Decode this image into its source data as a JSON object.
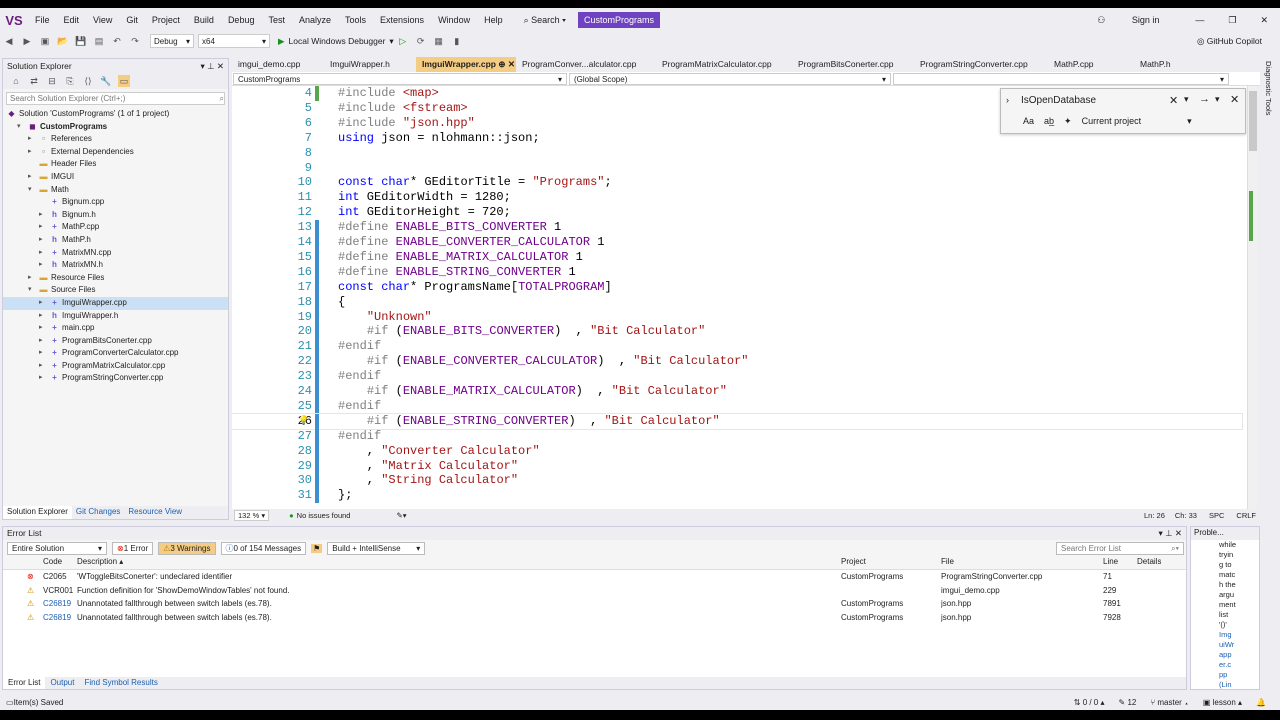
{
  "menu": {
    "logo": "VS",
    "items": [
      "File",
      "Edit",
      "View",
      "Git",
      "Project",
      "Build",
      "Debug",
      "Test",
      "Analyze",
      "Tools",
      "Extensions",
      "Window",
      "Help"
    ],
    "search": "Search",
    "solution_name": "CustomPrograms",
    "sign_in": "Sign in"
  },
  "toolbar": {
    "config": "Debug",
    "platform": "x64",
    "run_label": "Local Windows Debugger",
    "copilot": "GitHub Copilot"
  },
  "solution_explorer": {
    "title": "Solution Explorer",
    "search_placeholder": "Search Solution Explorer (Ctrl+;)",
    "solution_label": "Solution 'CustomPrograms' (1 of 1 project)",
    "items": [
      {
        "label": "CustomPrograms",
        "indent": 1,
        "icon": "project",
        "arrow": "▾",
        "bold": true
      },
      {
        "label": "References",
        "indent": 2,
        "icon": "ref",
        "arrow": "▸"
      },
      {
        "label": "External Dependencies",
        "indent": 2,
        "icon": "ref",
        "arrow": "▸"
      },
      {
        "label": "Header Files",
        "indent": 2,
        "icon": "folder",
        "arrow": ""
      },
      {
        "label": "IMGUI",
        "indent": 2,
        "icon": "folder",
        "arrow": "▸"
      },
      {
        "label": "Math",
        "indent": 2,
        "icon": "folder",
        "arrow": "▾"
      },
      {
        "label": "Bignum.cpp",
        "indent": 3,
        "icon": "cpp",
        "arrow": ""
      },
      {
        "label": "Bignum.h",
        "indent": 3,
        "icon": "h",
        "arrow": "▸"
      },
      {
        "label": "MathP.cpp",
        "indent": 3,
        "icon": "cpp",
        "arrow": "▸"
      },
      {
        "label": "MathP.h",
        "indent": 3,
        "icon": "h",
        "arrow": "▸"
      },
      {
        "label": "MatrixMN.cpp",
        "indent": 3,
        "icon": "cpp",
        "arrow": "▸"
      },
      {
        "label": "MatrixMN.h",
        "indent": 3,
        "icon": "h",
        "arrow": "▸"
      },
      {
        "label": "Resource Files",
        "indent": 2,
        "icon": "folder",
        "arrow": "▸"
      },
      {
        "label": "Source Files",
        "indent": 2,
        "icon": "folder",
        "arrow": "▾"
      },
      {
        "label": "ImguiWrapper.cpp",
        "indent": 3,
        "icon": "cpp",
        "arrow": "▸",
        "selected": true
      },
      {
        "label": "ImguiWrapper.h",
        "indent": 3,
        "icon": "h",
        "arrow": "▸"
      },
      {
        "label": "main.cpp",
        "indent": 3,
        "icon": "cpp",
        "arrow": "▸"
      },
      {
        "label": "ProgramBitsConerter.cpp",
        "indent": 3,
        "icon": "cpp",
        "arrow": "▸"
      },
      {
        "label": "ProgramConverterCalculator.cpp",
        "indent": 3,
        "icon": "cpp",
        "arrow": "▸"
      },
      {
        "label": "ProgramMatrixCalculator.cpp",
        "indent": 3,
        "icon": "cpp",
        "arrow": "▸"
      },
      {
        "label": "ProgramStringConverter.cpp",
        "indent": 3,
        "icon": "cpp",
        "arrow": "▸"
      }
    ],
    "bottom_tabs": [
      "Solution Explorer",
      "Git Changes",
      "Resource View"
    ]
  },
  "editor": {
    "tabs": [
      "imgui_demo.cpp",
      "ImguiWrapper.h",
      "ImguiWrapper.cpp",
      "ProgramConver...alculator.cpp",
      "ProgramMatrixCalculator.cpp",
      "ProgramBitsConerter.cpp",
      "ProgramStringConverter.cpp",
      "MathP.cpp",
      "MathP.h"
    ],
    "active_tab": 2,
    "nav_project": "CustomPrograms",
    "nav_scope": "(Global Scope)",
    "lines": [
      {
        "n": "4",
        "text": "#include <map>"
      },
      {
        "n": "5",
        "text": "#include <fstream>"
      },
      {
        "n": "6",
        "text": "#include \"json.hpp\""
      },
      {
        "n": "7",
        "text": "using json = nlohmann::json;"
      },
      {
        "n": "8",
        "text": ""
      },
      {
        "n": "9",
        "text": ""
      },
      {
        "n": "10",
        "text": "const char* GEditorTitle = \"Programs\";"
      },
      {
        "n": "11",
        "text": "int GEditorWidth = 1280;"
      },
      {
        "n": "12",
        "text": "int GEditorHeight = 720;"
      },
      {
        "n": "13",
        "text": "#define ENABLE_BITS_CONVERTER 1"
      },
      {
        "n": "14",
        "text": "#define ENABLE_CONVERTER_CALCULATOR 1"
      },
      {
        "n": "15",
        "text": "#define ENABLE_MATRIX_CALCULATOR 1"
      },
      {
        "n": "16",
        "text": "#define ENABLE_STRING_CONVERTER 1"
      },
      {
        "n": "17",
        "text": "const char* ProgramsName[TOTALPROGRAM]"
      },
      {
        "n": "18",
        "text": "{"
      },
      {
        "n": "19",
        "text": "    \"Unknown\""
      },
      {
        "n": "20",
        "text": "    #if (ENABLE_BITS_CONVERTER)  , \"Bit Calculator\""
      },
      {
        "n": "21",
        "text": "#endif"
      },
      {
        "n": "22",
        "text": "    #if (ENABLE_CONVERTER_CALCULATOR)  , \"Bit Calculator\""
      },
      {
        "n": "23",
        "text": "#endif"
      },
      {
        "n": "24",
        "text": "    #if (ENABLE_MATRIX_CALCULATOR)  , \"Bit Calculator\""
      },
      {
        "n": "25",
        "text": "#endif"
      },
      {
        "n": "26",
        "text": "    #if (ENABLE_STRING_CONVERTER)  , \"Bit Calculator\""
      },
      {
        "n": "27",
        "text": "#endif"
      },
      {
        "n": "28",
        "text": "    , \"Converter Calculator\""
      },
      {
        "n": "29",
        "text": "    , \"Matrix Calculator\""
      },
      {
        "n": "30",
        "text": "    , \"String Calculator\""
      },
      {
        "n": "31",
        "text": "};"
      }
    ],
    "current_line": "26",
    "find_text": "IsOpenDatabase",
    "find_scope": "Current project",
    "zoom": "132 %",
    "issues": "No issues found",
    "position": "Ln: 26",
    "column": "Ch: 33",
    "spc": "SPC",
    "crlf": "CRLF"
  },
  "error_list": {
    "title": "Error List",
    "scope": "Entire Solution",
    "errors": "1 Error",
    "warnings": "3 Warnings",
    "messages": "0 of 154 Messages",
    "build_filter": "Build + IntelliSense",
    "search_placeholder": "Search Error List",
    "columns": {
      "code": "Code",
      "description": "Description",
      "project": "Project",
      "file": "File",
      "line": "Line",
      "details": "Details"
    },
    "rows": [
      {
        "type": "error",
        "code": "C2065",
        "description": "'WToggleBitsConerter': undeclared identifier",
        "project": "CustomPrograms",
        "file": "ProgramStringConverter.cpp",
        "line": "71"
      },
      {
        "type": "warning",
        "code": "VCR001",
        "description": "Function definition for 'ShowDemoWindowTables' not found.",
        "project": "",
        "file": "imgui_demo.cpp",
        "line": "229"
      },
      {
        "type": "warning",
        "code": "C26819",
        "description": "Unannotated fallthrough between switch labels (es.78).",
        "project": "CustomPrograms",
        "file": "json.hpp",
        "line": "7891"
      },
      {
        "type": "warning",
        "code": "C26819",
        "description": "Unannotated fallthrough between switch labels (es.78).",
        "project": "CustomPrograms",
        "file": "json.hpp",
        "line": "7928"
      }
    ],
    "bottom_tabs": [
      "Error List",
      "Output",
      "Find Symbol Results"
    ]
  },
  "problems": {
    "title": "Proble...",
    "text_lines": [
      "while",
      "tryin",
      "g to",
      "matc",
      "h the",
      "argu",
      "ment",
      "list",
      "'()'"
    ],
    "link_lines": [
      "Img",
      "uiWr",
      "app",
      "er.c",
      "pp",
      "(Lin"
    ]
  },
  "status": {
    "left": "Item(s) Saved",
    "arrows": "0 / 0",
    "edits": "12",
    "branch": "master",
    "repo": "lesson"
  }
}
